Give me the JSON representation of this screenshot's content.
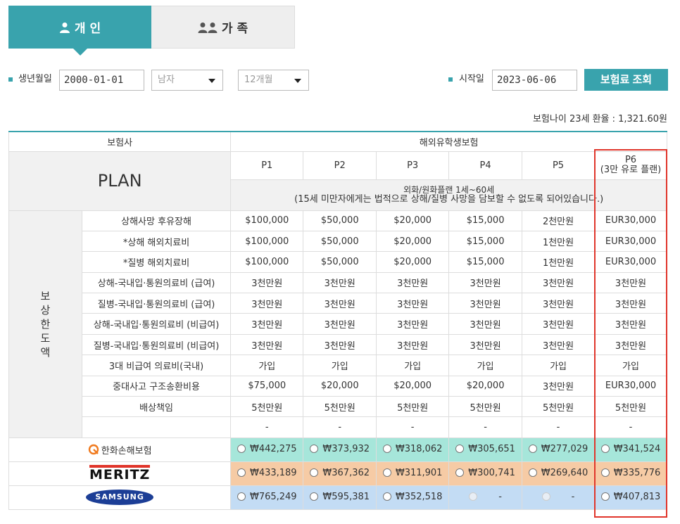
{
  "tabs": [
    {
      "label": "개 인",
      "icon": "person-icon",
      "active": true
    },
    {
      "label": "가 족",
      "icon": "people-icon",
      "active": false
    }
  ],
  "filters": {
    "birth_label": "생년월일",
    "birth_value": "2000-01-01",
    "gender_value": "남자",
    "period_value": "12개월",
    "start_label": "시작일",
    "start_value": "2023-06-06",
    "search_button": "보험료 조회"
  },
  "age_rate": "보험나이 23세 환율 : 1,321.60원",
  "table": {
    "insurer_header": "보험사",
    "product_header": "해외유학생보험",
    "plan_title": "PLAN",
    "plans": [
      {
        "name": "P1",
        "sub": ""
      },
      {
        "name": "P2",
        "sub": ""
      },
      {
        "name": "P3",
        "sub": ""
      },
      {
        "name": "P4",
        "sub": ""
      },
      {
        "name": "P5",
        "sub": ""
      },
      {
        "name": "P6",
        "sub": "(3만 유로 플랜)"
      }
    ],
    "note_line1": "외화/원화플랜 1세~60세",
    "note_line2": "(15세 미만자에게는 법적으로 상해/질병 사망을 담보할 수 없도록 되어있습니다.)",
    "coverage_category": "보상한도액",
    "coverage_category_chars": [
      "보",
      "상",
      "한",
      "도",
      "액"
    ],
    "coverage": [
      {
        "name": "상해사망 후유장해",
        "values": [
          "$100,000",
          "$50,000",
          "$20,000",
          "$15,000",
          "2천만원",
          "EUR30,000"
        ]
      },
      {
        "name": "*상해 해외치료비",
        "values": [
          "$100,000",
          "$50,000",
          "$20,000",
          "$15,000",
          "1천만원",
          "EUR30,000"
        ]
      },
      {
        "name": "*질병 해외치료비",
        "values": [
          "$100,000",
          "$50,000",
          "$20,000",
          "$15,000",
          "1천만원",
          "EUR30,000"
        ]
      },
      {
        "name": "상해-국내입·통원의료비 (급여)",
        "values": [
          "3천만원",
          "3천만원",
          "3천만원",
          "3천만원",
          "3천만원",
          "3천만원"
        ]
      },
      {
        "name": "질병-국내입·통원의료비 (급여)",
        "values": [
          "3천만원",
          "3천만원",
          "3천만원",
          "3천만원",
          "3천만원",
          "3천만원"
        ]
      },
      {
        "name": "상해-국내입·통원의료비 (비급여)",
        "values": [
          "3천만원",
          "3천만원",
          "3천만원",
          "3천만원",
          "3천만원",
          "3천만원"
        ]
      },
      {
        "name": "질병-국내입·통원의료비 (비급여)",
        "values": [
          "3천만원",
          "3천만원",
          "3천만원",
          "3천만원",
          "3천만원",
          "3천만원"
        ]
      },
      {
        "name": "3대 비급여 의료비(국내)",
        "values": [
          "가입",
          "가입",
          "가입",
          "가입",
          "가입",
          "가입"
        ]
      },
      {
        "name": "중대사고 구조송환비용",
        "values": [
          "$75,000",
          "$20,000",
          "$20,000",
          "$20,000",
          "3천만원",
          "EUR30,000"
        ]
      },
      {
        "name": "배상책임",
        "values": [
          "5천만원",
          "5천만원",
          "5천만원",
          "5천만원",
          "5천만원",
          "5천만원"
        ]
      },
      {
        "name": "",
        "values": [
          "-",
          "-",
          "-",
          "-",
          "-",
          "-"
        ]
      }
    ],
    "companies": [
      {
        "name": "한화손해보험",
        "logo": "hanwha-logo",
        "row_color": "#a6e6da",
        "prices": [
          "₩442,275",
          "₩373,932",
          "₩318,062",
          "₩305,651",
          "₩277,029",
          "₩341,524"
        ],
        "enabled": [
          true,
          true,
          true,
          true,
          true,
          true
        ]
      },
      {
        "name": "MERITZ",
        "logo": "meritz-logo",
        "row_color": "#f6cba5",
        "prices": [
          "₩433,189",
          "₩367,362",
          "₩311,901",
          "₩300,741",
          "₩269,640",
          "₩335,776"
        ],
        "enabled": [
          true,
          true,
          true,
          true,
          true,
          true
        ]
      },
      {
        "name": "SAMSUNG",
        "logo": "samsung-logo",
        "row_color": "#c3dcf4",
        "prices": [
          "₩765,249",
          "₩595,381",
          "₩352,518",
          "-",
          "-",
          "₩407,813"
        ],
        "enabled": [
          true,
          true,
          true,
          false,
          false,
          true
        ]
      }
    ]
  },
  "colors": {
    "accent": "#39a3ad",
    "highlight": "#e0352b"
  }
}
